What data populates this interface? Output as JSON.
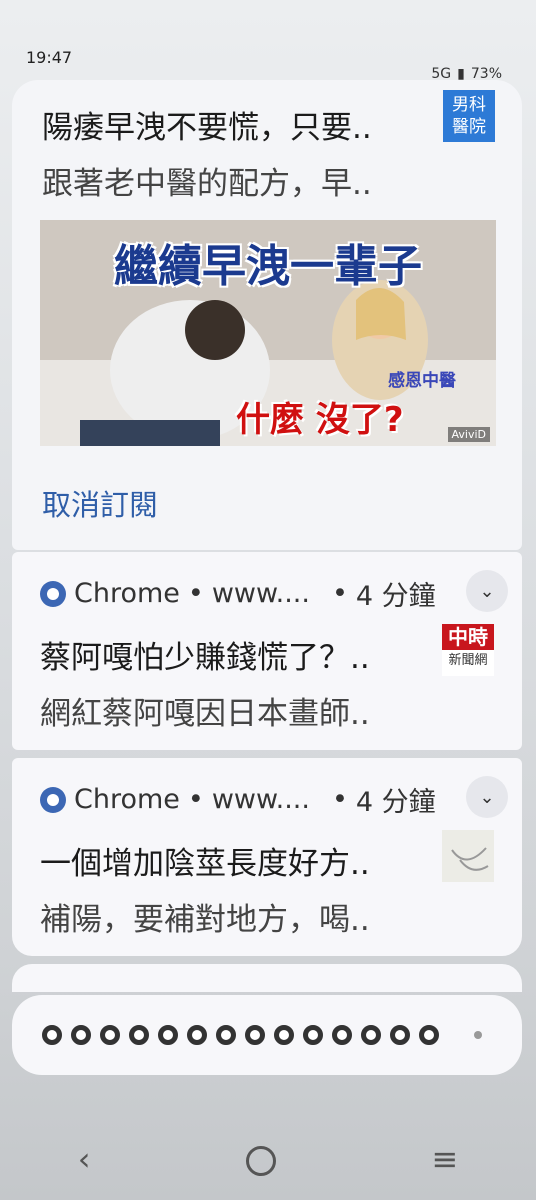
{
  "status": {
    "time": "19:47",
    "network": "5G",
    "battery": "73%"
  },
  "notifications": [
    {
      "title": "陽痿早洩不要慌，只要..",
      "body": "跟著老中醫的配方，早..",
      "thumb_text": "男科醫院",
      "hero": {
        "headline": "繼續早洩一輩子",
        "caption": "什麼 沒了?",
        "badge": "感恩中醫",
        "watermark": "AviviD"
      },
      "action": "取消訂閱"
    },
    {
      "app": "Chrome",
      "site": "www....",
      "time": "4 分鐘",
      "title": "蔡阿嘎怕少賺錢慌了？..",
      "body": "網紅蔡阿嘎因日本畫師..",
      "thumb_top": "中時",
      "thumb_bottom": "新聞網"
    },
    {
      "app": "Chrome",
      "site": "www....",
      "time": "4 分鐘",
      "title": "一個增加陰莖長度好方..",
      "body": "補陽，要補對地方，喝.."
    }
  ],
  "colors": {
    "accent": "#2f5ea8",
    "chrome_blue": "#3c67b4"
  }
}
